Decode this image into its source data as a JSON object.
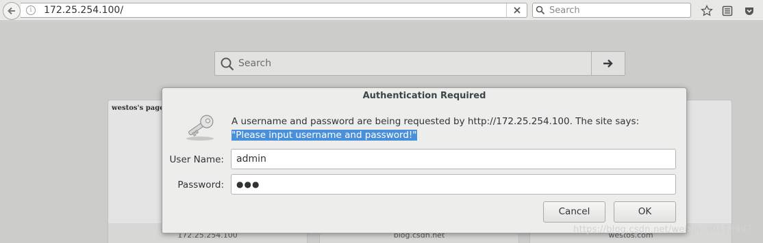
{
  "browser": {
    "url": "172.25.254.100/",
    "search_placeholder": "Search"
  },
  "new_tab": {
    "search_placeholder": "Search",
    "tiles": [
      {
        "title": "westos's page",
        "caption": "172.25.254.100"
      },
      {
        "title": "",
        "caption": "blog.csdn.net"
      },
      {
        "title": "",
        "caption": "westos.com"
      }
    ]
  },
  "dialog": {
    "title": "Authentication Required",
    "message_prefix": "A username and password are being requested by http://172.25.254.100. The site says: ",
    "message_quote": "\"Please input username and password!\"",
    "username_label": "User Name:",
    "username_value": "admin",
    "password_label": "Password:",
    "password_value": "●●●",
    "cancel_label": "Cancel",
    "ok_label": "OK"
  },
  "watermark": "https://blog.csdn.net/weixin_40172997"
}
